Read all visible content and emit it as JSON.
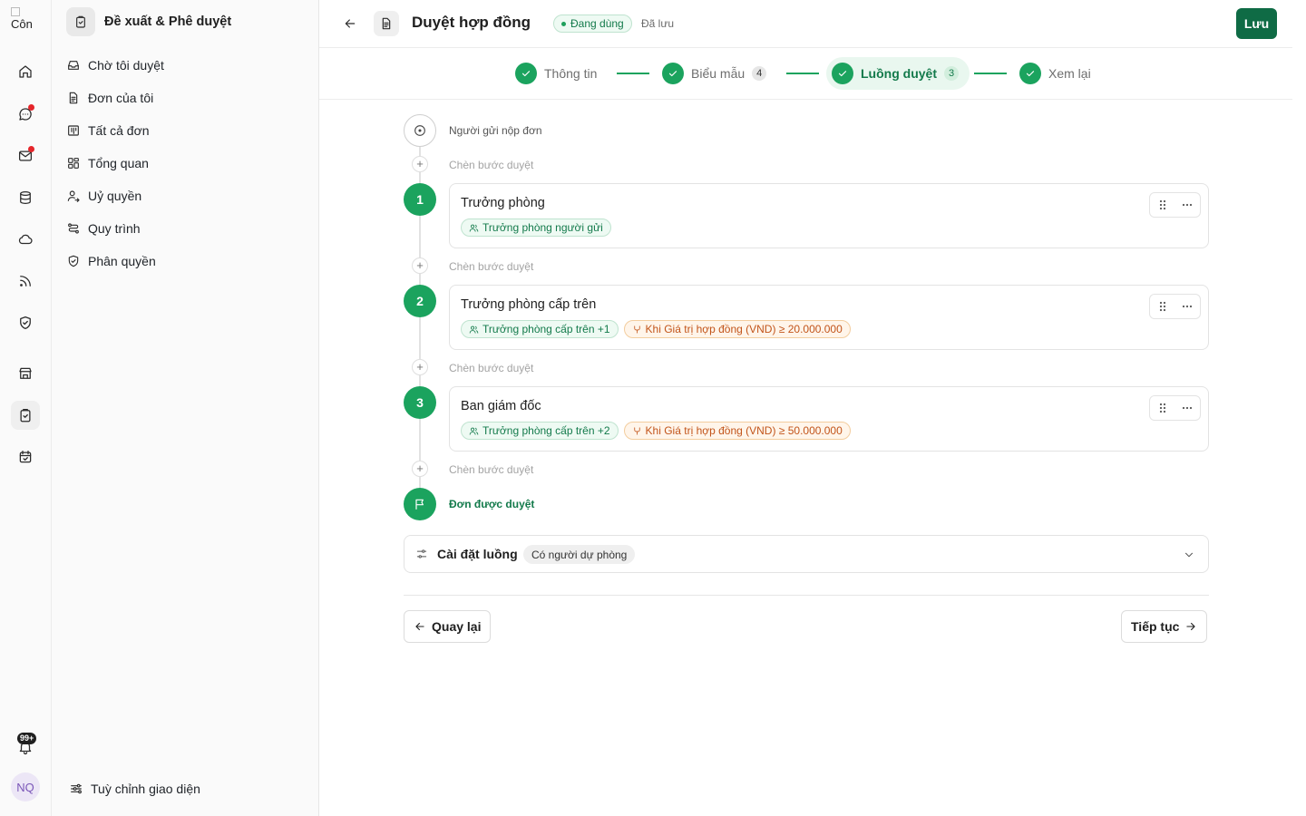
{
  "rail": {
    "logo_alt": "Côn",
    "notification_badge": "99+",
    "avatar_initials": "NQ",
    "items": [
      {
        "icon": "home-icon"
      },
      {
        "icon": "chat-icon",
        "dot": true
      },
      {
        "icon": "mail-icon",
        "dot": true
      },
      {
        "icon": "database-icon"
      },
      {
        "icon": "cloud-icon"
      },
      {
        "icon": "rss-icon"
      },
      {
        "icon": "shield-check-icon"
      },
      {
        "icon": "store-icon"
      },
      {
        "icon": "clipboard-check-icon",
        "active": true
      },
      {
        "icon": "calendar-check-icon"
      }
    ]
  },
  "sidebar": {
    "title": "Đề xuất & Phê duyệt",
    "items": [
      {
        "label": "Chờ tôi duyệt",
        "icon": "inbox-icon"
      },
      {
        "label": "Đơn của tôi",
        "icon": "document-icon"
      },
      {
        "label": "Tất cả đơn",
        "icon": "kanban-icon"
      },
      {
        "label": "Tổng quan",
        "icon": "dashboard-icon"
      },
      {
        "label": "Uỷ quyền",
        "icon": "user-delegate-icon"
      },
      {
        "label": "Quy trình",
        "icon": "workflow-icon"
      },
      {
        "label": "Phân quyền",
        "icon": "shield-icon"
      }
    ],
    "footer_label": "Tuỳ chỉnh giao diện"
  },
  "header": {
    "title": "Duyệt hợp đồng",
    "status": "Đang dùng",
    "saved_text": "Đã lưu",
    "save_label": "Lưu"
  },
  "stepper": {
    "steps": [
      {
        "label": "Thông tin",
        "count": null,
        "done": true
      },
      {
        "label": "Biểu mẫu",
        "count": "4",
        "done": true
      },
      {
        "label": "Luồng duyệt",
        "count": "3",
        "done": true,
        "active": true
      },
      {
        "label": "Xem lại",
        "count": null,
        "done": true
      }
    ]
  },
  "flow": {
    "start_label": "Người gửi nộp đơn",
    "insert_label": "Chèn bước duyệt",
    "end_label": "Đơn được duyệt",
    "steps": [
      {
        "number": "1",
        "title": "Trưởng phòng",
        "approver": "Trưởng phòng người gửi",
        "condition": null
      },
      {
        "number": "2",
        "title": "Trưởng phòng cấp trên",
        "approver": "Trưởng phòng cấp trên +1",
        "condition": "Khi Giá trị hợp đồng (VND) ≥ 20.000.000"
      },
      {
        "number": "3",
        "title": "Ban giám đốc",
        "approver": "Trưởng phòng cấp trên +2",
        "condition": "Khi Giá trị hợp đồng (VND) ≥ 50.000.000"
      }
    ],
    "settings_label": "Cài đặt luồng",
    "settings_pill": "Có người dự phòng"
  },
  "footer": {
    "back_label": "Quay lại",
    "next_label": "Tiếp tục"
  },
  "colors": {
    "accent": "#1ba35e",
    "save_button": "#0f6b45",
    "condition_orange": "#c2541a",
    "notification_dot": "#e5252a"
  }
}
